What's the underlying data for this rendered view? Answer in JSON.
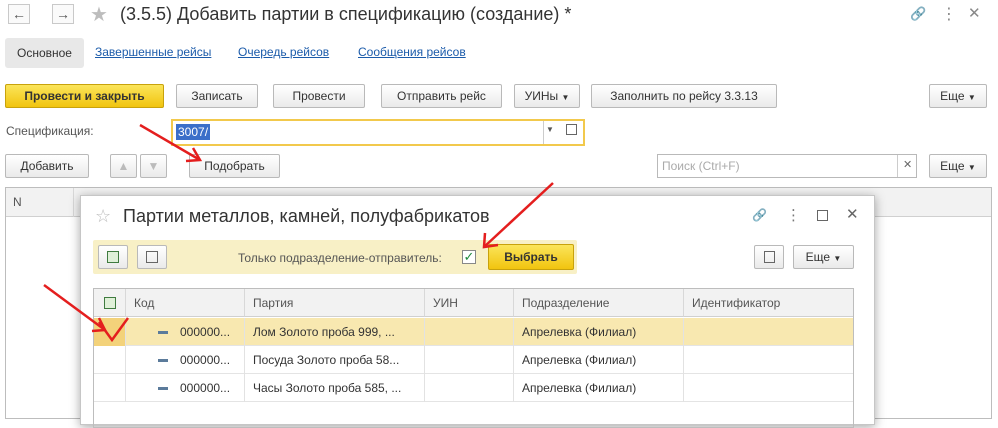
{
  "window": {
    "title": "(3.5.5) Добавить партии в спецификацию (создание) *",
    "nav_back": "←",
    "nav_forward": "→",
    "star": "★",
    "link_icon": "🔗",
    "more": "⋮",
    "close": "✕"
  },
  "tabs": {
    "active": "Основное",
    "links": [
      "Завершенные рейсы",
      "Очередь рейсов",
      "Сообщения рейсов"
    ]
  },
  "toolbar": {
    "post_close": "Провести и закрыть",
    "save": "Записать",
    "post": "Провести",
    "send_trip": "Отправить рейс",
    "uins": "УИНы",
    "fill_by_trip": "Заполнить по рейсу 3.3.13",
    "more": "Еще"
  },
  "specification": {
    "label": "Спецификация:",
    "value": "3007/"
  },
  "table_toolbar": {
    "add": "Добавить",
    "pick": "Подобрать",
    "search_placeholder": "Поиск (Ctrl+F)",
    "more": "Еще"
  },
  "main_table": {
    "col_n": "N"
  },
  "modal": {
    "title": "Партии металлов, камней, полуфабрикатов",
    "only_sender_label": "Только подразделение-отправитель:",
    "only_sender_checked": true,
    "select": "Выбрать",
    "more": "Еще",
    "columns": [
      "Код",
      "Партия",
      "УИН",
      "Подразделение",
      "Идентификатор"
    ],
    "rows": [
      {
        "code": "000000...",
        "batch": "Лом  Золото проба 999, ...",
        "uin": "",
        "dept": "Апрелевка (Филиал)",
        "id": "",
        "selected": true
      },
      {
        "code": "000000...",
        "batch": "Посуда Золото проба 58...",
        "uin": "",
        "dept": "Апрелевка (Филиал)",
        "id": "",
        "selected": false
      },
      {
        "code": "000000...",
        "batch": "Часы Золото проба 585, ...",
        "uin": "",
        "dept": "Апрелевка (Филиал)",
        "id": "",
        "selected": false
      }
    ]
  },
  "colors": {
    "accent_yellow": "#f1c40f",
    "link_blue": "#1b5baa",
    "selected_row": "#f8e8b0",
    "annotation_red": "#e41e1e"
  }
}
